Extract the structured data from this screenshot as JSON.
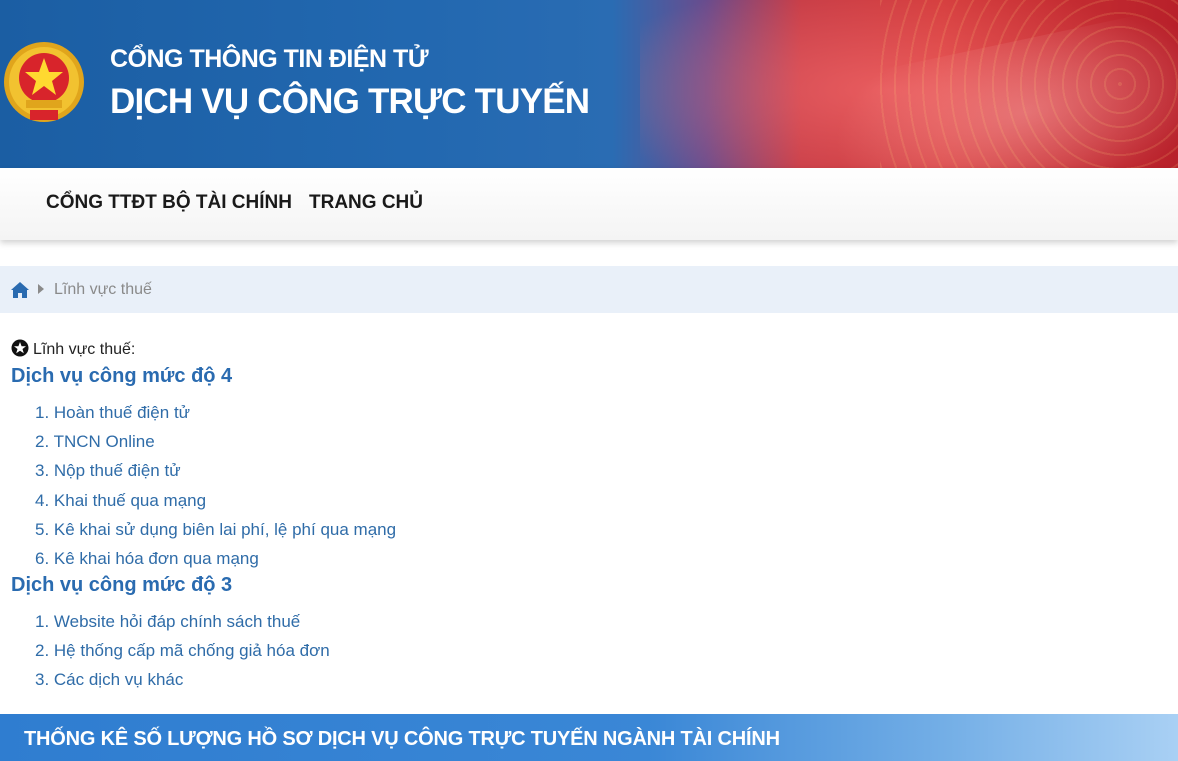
{
  "header": {
    "title_line1": "CỔNG THÔNG TIN ĐIỆN TỬ",
    "title_line2": "DỊCH VỤ CÔNG TRỰC TUYẾN"
  },
  "nav": {
    "items": [
      {
        "label": "CỔNG TTĐT BỘ TÀI CHÍNH"
      },
      {
        "label": "TRANG CHỦ"
      }
    ]
  },
  "breadcrumb": {
    "home_icon": "home-icon",
    "current": "Lĩnh vực thuế"
  },
  "content": {
    "section_label": "Lĩnh vực thuế:",
    "groups": [
      {
        "heading": "Dịch vụ công mức độ 4",
        "items": [
          "1. Hoàn thuế điện tử",
          "2. TNCN Online",
          "3. Nộp thuế điện tử",
          "4. Khai thuế qua mạng",
          "5. Kê khai sử dụng biên lai phí, lệ phí qua mạng",
          "6. Kê khai hóa đơn qua mạng"
        ]
      },
      {
        "heading": "Dịch vụ công mức độ 3",
        "items": [
          "1. Website hỏi đáp chính sách thuế",
          "2. Hệ thống cấp mã chống giả hóa đơn",
          "3. Các dịch vụ khác"
        ]
      }
    ]
  },
  "stats": {
    "title": "THỐNG KÊ SỐ LƯỢNG HỒ SƠ DỊCH VỤ CÔNG TRỰC TUYẾN NGÀNH TÀI CHÍNH"
  },
  "colors": {
    "banner_blue": "#1b5ea3",
    "banner_red": "#d23a3a",
    "link_blue": "#2f6ca8",
    "heading_blue": "#2a6bb0",
    "breadcrumb_bg": "#e9f0f9",
    "stats_bar": "#3a87d6"
  }
}
